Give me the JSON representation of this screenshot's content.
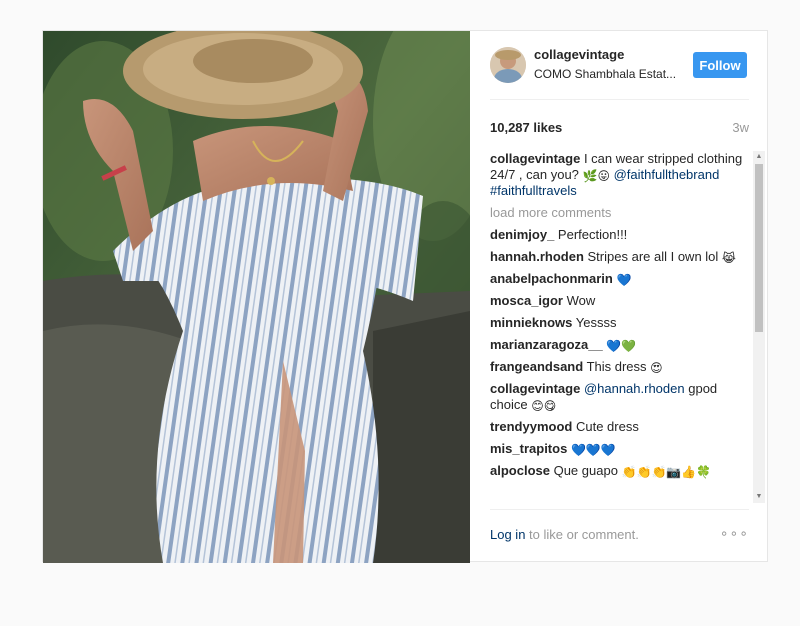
{
  "header": {
    "username": "collagevintage",
    "location": "COMO Shambhala Estat...",
    "follow_label": "Follow"
  },
  "stats": {
    "likes": "10,287 likes",
    "age": "3w"
  },
  "caption": {
    "user": "collagevintage",
    "text": "I can wear stripped clothing 24/7 , can you? ",
    "emoji": "🌿😛",
    "mention": "@faithfullthebrand",
    "hashtag": "#faithfulltravels"
  },
  "load_more": "load more comments",
  "comments": [
    {
      "user": "denimjoy_",
      "text": "Perfection!!!",
      "emoji": ""
    },
    {
      "user": "hannah.rhoden",
      "text": "Stripes are all I own lol",
      "emoji": "😹"
    },
    {
      "user": "anabelpachonmarin",
      "text": "",
      "emoji": "💙"
    },
    {
      "user": "mosca_igor",
      "text": "Wow",
      "emoji": ""
    },
    {
      "user": "minnieknows",
      "text": "Yessss",
      "emoji": ""
    },
    {
      "user": "marianzaragoza__",
      "text": "",
      "emoji": "💙💚"
    },
    {
      "user": "frangeandsand",
      "text": "This dress",
      "emoji": "😍"
    },
    {
      "user": "collagevintage",
      "mention": "@hannah.rhoden",
      "text": "gpod choice",
      "emoji": "😊😋"
    },
    {
      "user": "trendyymood",
      "text": "Cute dress",
      "emoji": ""
    },
    {
      "user": "mis_trapitos",
      "text": "",
      "emoji": "💙💙💙"
    },
    {
      "user": "alpoclose",
      "text": "Que guapo",
      "emoji": "👏👏👏📷👍🍀"
    }
  ],
  "footer": {
    "login_link": "Log in",
    "login_rest": " to like or comment.",
    "more_icon": "ellipsis-icon",
    "more_label": "∘∘∘"
  }
}
